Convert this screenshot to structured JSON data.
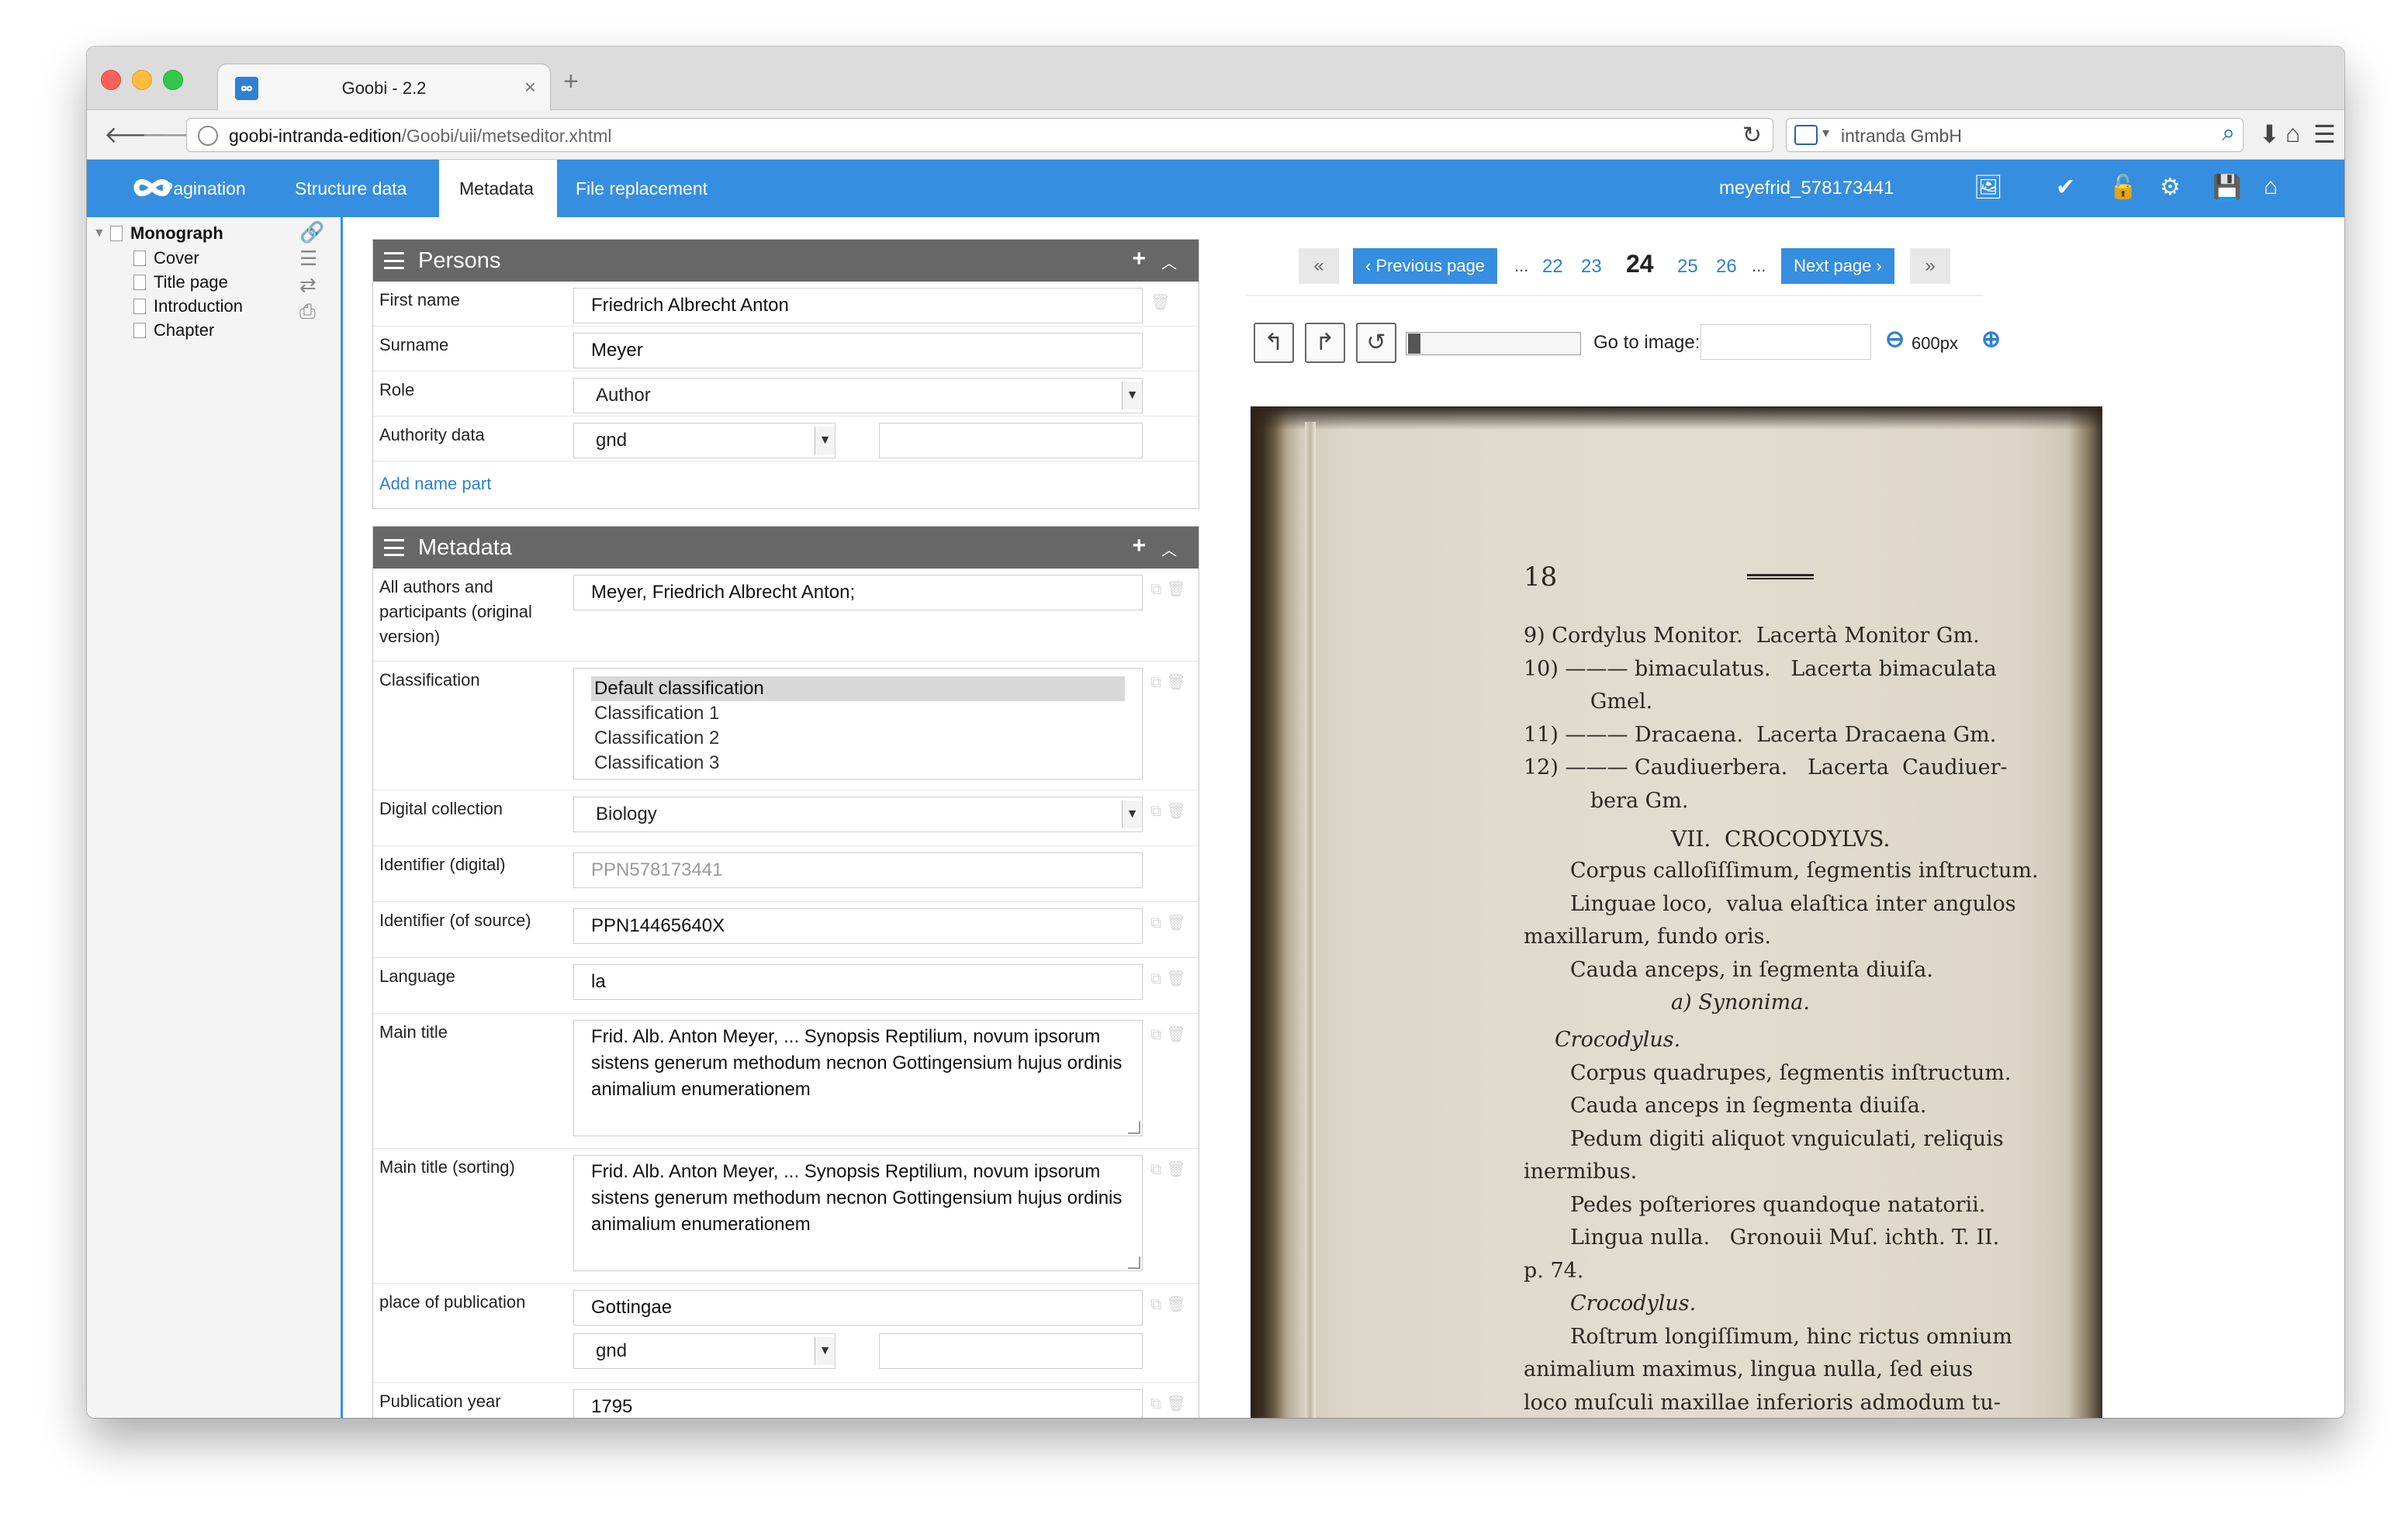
{
  "browser": {
    "tab_title": "Goobi - 2.2",
    "tab_close": "×",
    "new_tab": "+",
    "url_host": "goobi-intranda-edition",
    "url_path": "/Goobi/uii/metseditor.xhtml",
    "search_placeholder": "intranda GmbH",
    "icons": [
      "back-icon",
      "forward-icon",
      "globe-icon",
      "reload-icon",
      "search-engine-icon",
      "search-icon",
      "download-icon",
      "home-icon",
      "menu-icon"
    ]
  },
  "appbar": {
    "tabs": [
      {
        "label": "Pagination",
        "active": false
      },
      {
        "label": "Structure data",
        "active": false
      },
      {
        "label": "Metadata",
        "active": true
      },
      {
        "label": "File replacement",
        "active": false
      }
    ],
    "process_name": "meyefrid_578173441",
    "icons": [
      "image-icon",
      "check-icon",
      "unlock-icon",
      "gear-icon",
      "save-icon",
      "home-icon"
    ],
    "colors": {
      "bar": "#368ee0",
      "active_tab": "#ffffff"
    }
  },
  "sidebar": {
    "root": "Monograph",
    "children": [
      "Cover",
      "Title page",
      "Introduction",
      "Chapter"
    ],
    "icons": [
      "link-icon",
      "list-icon",
      "swap-icon",
      "print-icon"
    ]
  },
  "persons": {
    "title": "Persons",
    "first_name_label": "First name",
    "first_name": "Friedrich Albrecht Anton",
    "surname_label": "Surname",
    "surname": "Meyer",
    "role_label": "Role",
    "role": "Author",
    "authority_label": "Authority data",
    "authority": "gnd",
    "authority_value": "",
    "add_name_part": "Add name part"
  },
  "metadata": {
    "title": "Metadata",
    "authors_label": "All authors and participants (original version)",
    "authors": "Meyer, Friedrich Albrecht Anton;",
    "classification_label": "Classification",
    "classification_options": [
      "Default classification",
      "Classification 1",
      "Classification 2",
      "Classification 3"
    ],
    "classification_selected": "Default classification",
    "collection_label": "Digital collection",
    "collection": "Biology",
    "id_digital_label": "Identifier (digital)",
    "id_digital": "PPN578173441",
    "id_source_label": "Identifier (of source)",
    "id_source": "PPN14465640X",
    "language_label": "Language",
    "language": "la",
    "main_title_label": "Main title",
    "main_title": "Frid. Alb. Anton Meyer, ... Synopsis Reptilium, novum ipsorum sistens generum methodum necnon Gottingensium hujus ordinis animalium enumerationem",
    "main_title_sort_label": "Main title (sorting)",
    "main_title_sort": "Frid. Alb. Anton Meyer, ... Synopsis Reptilium, novum ipsorum sistens generum methodum necnon Gottingensium hujus ordinis animalium enumerationem",
    "place_label": "place of publication",
    "place": "Gottingae",
    "place_authority": "gnd",
    "place_authority_value": "",
    "year_label": "Publication year",
    "year": "1795"
  },
  "viewer": {
    "first": "«",
    "prev": "‹ Previous page",
    "pages_before": [
      "22",
      "23"
    ],
    "current": "24",
    "pages_after": [
      "25",
      "26"
    ],
    "ellipsis": "...",
    "next": "Next page ›",
    "last": "»",
    "goto_label": "Go to image:",
    "goto_value": "",
    "zoom": "600px",
    "icons": [
      "rotate-left-icon",
      "rotate-right-icon",
      "reset-icon",
      "zoom-out-icon",
      "zoom-in-icon",
      "bookmark-icon"
    ],
    "page_text": {
      "page_number": "18",
      "lines": [
        "9) Cordylus Monitor.  Lacertà Monitor Gm.",
        "10) ——— bimaculatus.   Lacerta bimaculata",
        "          Gmel.",
        "11) ——— Dracaena.  Lacerta Dracaena Gm.",
        "12) ——— Caudiuerbera.   Lacerta  Caudiuer-",
        "          bera Gm.",
        "VII.  CROCODYLVS.",
        "Corpus calloſiſſimum, ſegmentis inſtructum.",
        "Linguae loco,  valua elaſtica inter angulos",
        "maxillarum, fundo oris.",
        "Cauda anceps, in ſegmenta diuiſa.",
        "a) Synonima.",
        "Crocodylus.",
        "Corpus quadrupes, ſegmentis inſtructum.",
        "Cauda anceps in ſegmenta diuiſa.",
        "Pedum digiti aliquot vnguiculati, reliquis",
        "inermibus.",
        "Pedes poſteriores quandoque natatorii.",
        "Lingua nulla.   Gronouii Muſ. ichth. T. II.",
        "p. 74.",
        "Crocodylus.",
        "Roſtrum longiſſimum, hinc rictus omnium",
        "animalium maximus, lingua nulla, ſed eius",
        "loco muſculi maxillae inferioris admodum tu-"
      ]
    }
  }
}
